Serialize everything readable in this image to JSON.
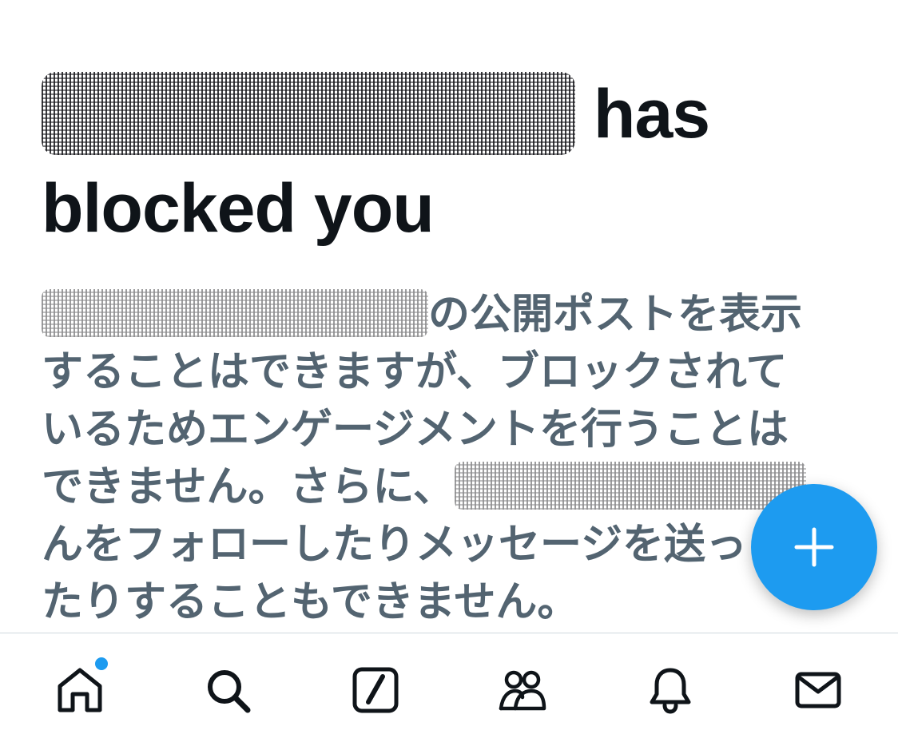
{
  "headline": {
    "line1_suffix": "has",
    "line2": "blocked you"
  },
  "body": {
    "line1_suffix": "の公開ポストを表示",
    "line2": "することはできますが、ブロックされて",
    "line3": "いるためエンゲージメントを行うことは",
    "line4_prefix": "できません。さらに、",
    "line5": "んをフォローしたりメッセージを送っ",
    "line6": "たりすることもできません。"
  },
  "fab": {
    "icon": "plus-icon",
    "color": "#1d9bf0"
  },
  "tabbar": {
    "items": [
      {
        "icon": "home-icon",
        "notification_dot": true
      },
      {
        "icon": "search-icon"
      },
      {
        "icon": "grok-icon"
      },
      {
        "icon": "communities-icon"
      },
      {
        "icon": "notifications-bell-icon"
      },
      {
        "icon": "messages-envelope-icon"
      }
    ]
  },
  "colors": {
    "text_primary": "#0f1419",
    "text_secondary": "#536471",
    "accent": "#1d9bf0"
  }
}
